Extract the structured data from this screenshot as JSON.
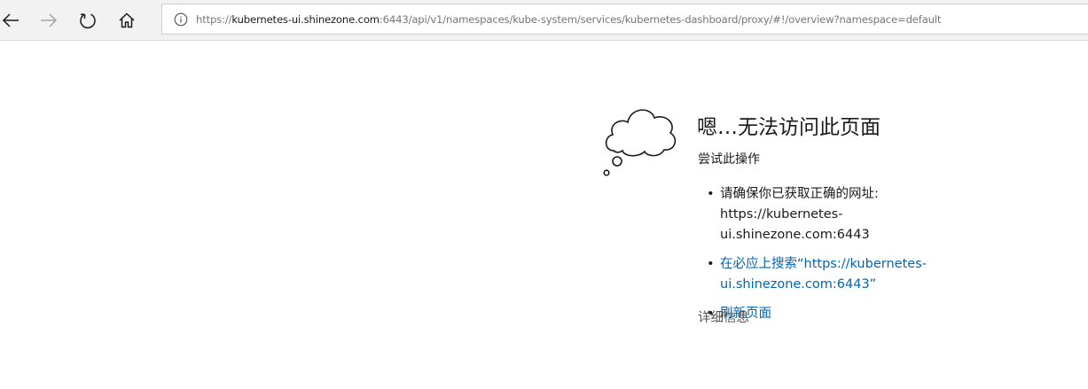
{
  "browser": {
    "address_bar": {
      "url_scheme": "https://",
      "url_host": "kubernetes-ui.shinezone.com",
      "url_rest": ":6443/api/v1/namespaces/kube-system/services/kubernetes-dashboard/proxy/#!/overview?namespace=default"
    },
    "icons": {
      "back": "back-arrow-icon",
      "forward": "forward-arrow-icon",
      "refresh": "refresh-icon",
      "home": "home-icon",
      "info": "info-icon"
    }
  },
  "error_page": {
    "illustration": "thought-cloud-icon",
    "title": "嗯…无法访问此页面",
    "try_label": "尝试此操作",
    "suggestions": [
      {
        "bullet": "•",
        "text": "请确保你已获取正确的网址:",
        "url_part1": "https://kubernetes-",
        "url_part2": "ui.shinezone.com:6443"
      },
      {
        "bullet": "•",
        "line1": "在必应上搜索“https://kubernetes-",
        "line2": "ui.shinezone.com:6443”"
      },
      {
        "bullet": "•",
        "text": "刷新页面"
      }
    ],
    "details_link": "详细信息"
  },
  "colors": {
    "toolbar_bg": "#f2f2f2",
    "link": "#0064b4",
    "text": "#1a1a1a",
    "muted": "#767676"
  }
}
